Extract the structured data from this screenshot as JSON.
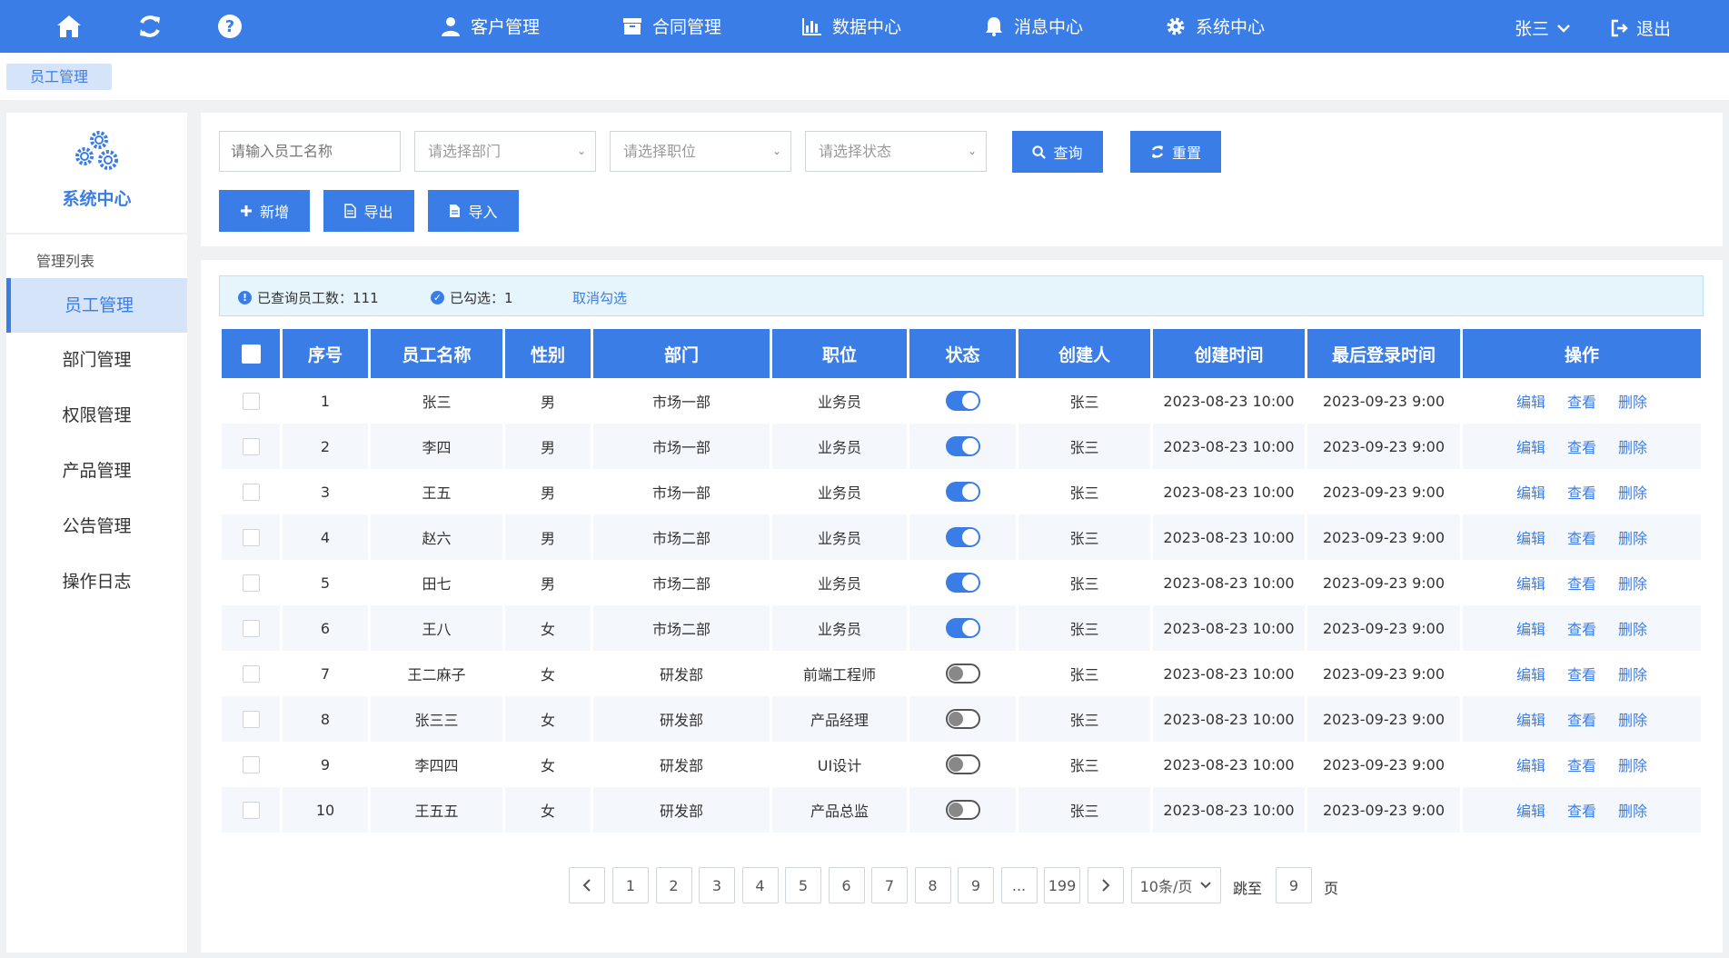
{
  "topbar": {
    "nav": [
      {
        "label": "客户管理",
        "icon": "user-icon"
      },
      {
        "label": "合同管理",
        "icon": "archive-icon"
      },
      {
        "label": "数据中心",
        "icon": "bar-chart-icon"
      },
      {
        "label": "消息中心",
        "icon": "bell-icon"
      },
      {
        "label": "系统中心",
        "icon": "gear-icon"
      }
    ],
    "user": "张三",
    "logout": "退出"
  },
  "breadcrumb": "员工管理",
  "sidebar": {
    "title": "系统中心",
    "section_label": "管理列表",
    "items": [
      "员工管理",
      "部门管理",
      "权限管理",
      "产品管理",
      "公告管理",
      "操作日志"
    ],
    "active_index": 0
  },
  "filter": {
    "name_placeholder": "请输入员工名称",
    "dept_placeholder": "请选择部门",
    "position_placeholder": "请选择职位",
    "status_placeholder": "请选择状态",
    "query": "查询",
    "reset": "重置",
    "add": "新增",
    "export": "导出",
    "import": "导入"
  },
  "info": {
    "queried": "已查询员工数：111",
    "selected": "已勾选：1",
    "cancel": "取消勾选"
  },
  "table": {
    "headers": [
      "序号",
      "员工名称",
      "性别",
      "部门",
      "职位",
      "状态",
      "创建人",
      "创建时间",
      "最后登录时间",
      "操作"
    ],
    "rows": [
      {
        "no": "1",
        "name": "张三",
        "gender": "男",
        "dept": "市场一部",
        "position": "业务员",
        "status": true,
        "creator": "张三",
        "created": "2023-08-23 10:00",
        "last_login": "2023-09-23 9:00"
      },
      {
        "no": "2",
        "name": "李四",
        "gender": "男",
        "dept": "市场一部",
        "position": "业务员",
        "status": true,
        "creator": "张三",
        "created": "2023-08-23 10:00",
        "last_login": "2023-09-23 9:00"
      },
      {
        "no": "3",
        "name": "王五",
        "gender": "男",
        "dept": "市场一部",
        "position": "业务员",
        "status": true,
        "creator": "张三",
        "created": "2023-08-23 10:00",
        "last_login": "2023-09-23 9:00"
      },
      {
        "no": "4",
        "name": "赵六",
        "gender": "男",
        "dept": "市场二部",
        "position": "业务员",
        "status": true,
        "creator": "张三",
        "created": "2023-08-23 10:00",
        "last_login": "2023-09-23 9:00"
      },
      {
        "no": "5",
        "name": "田七",
        "gender": "男",
        "dept": "市场二部",
        "position": "业务员",
        "status": true,
        "creator": "张三",
        "created": "2023-08-23 10:00",
        "last_login": "2023-09-23 9:00"
      },
      {
        "no": "6",
        "name": "王八",
        "gender": "女",
        "dept": "市场二部",
        "position": "业务员",
        "status": true,
        "creator": "张三",
        "created": "2023-08-23 10:00",
        "last_login": "2023-09-23 9:00"
      },
      {
        "no": "7",
        "name": "王二麻子",
        "gender": "女",
        "dept": "研发部",
        "position": "前端工程师",
        "status": false,
        "creator": "张三",
        "created": "2023-08-23 10:00",
        "last_login": "2023-09-23 9:00"
      },
      {
        "no": "8",
        "name": "张三三",
        "gender": "女",
        "dept": "研发部",
        "position": "产品经理",
        "status": false,
        "creator": "张三",
        "created": "2023-08-23 10:00",
        "last_login": "2023-09-23 9:00"
      },
      {
        "no": "9",
        "name": "李四四",
        "gender": "女",
        "dept": "研发部",
        "position": "UI设计",
        "status": false,
        "creator": "张三",
        "created": "2023-08-23 10:00",
        "last_login": "2023-09-23 9:00"
      },
      {
        "no": "10",
        "name": "王五五",
        "gender": "女",
        "dept": "研发部",
        "position": "产品总监",
        "status": false,
        "creator": "张三",
        "created": "2023-08-23 10:00",
        "last_login": "2023-09-23 9:00"
      }
    ],
    "ops": [
      "编辑",
      "查看",
      "删除"
    ]
  },
  "pagination": {
    "pages": [
      "1",
      "2",
      "3",
      "4",
      "5",
      "6",
      "7",
      "8",
      "9",
      "...",
      "199"
    ],
    "page_size": "10条/页",
    "jump_label": "跳至",
    "jump_value": "9",
    "page_unit": "页"
  },
  "colors": {
    "primary": "#3b7de6",
    "light": "#d5e4f8"
  }
}
